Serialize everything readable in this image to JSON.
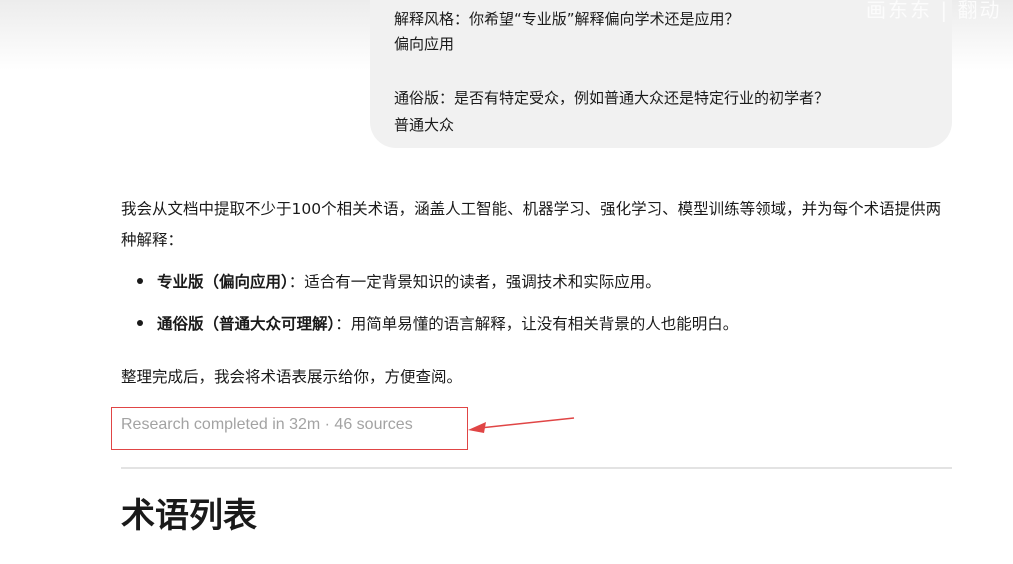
{
  "user_message": {
    "style_question": "解释风格：你希望“专业版”解释偏向学术还是应用？",
    "style_answer": "偏向应用",
    "audience_question": "通俗版：是否有特定受众，例如普通大众还是特定行业的初学者？",
    "audience_answer": "普通大众"
  },
  "watermark": "画东东 | 翻动",
  "assistant_reply": {
    "intro": "我会从文档中提取不少于100个相关术语，涵盖人工智能、机器学习、强化学习、模型训练等领域，并为每个术语提供两种解释：",
    "bullets": [
      {
        "title": "专业版（偏向应用）",
        "text": "：适合有一定背景知识的读者，强调技术和实际应用。"
      },
      {
        "title": "通俗版（普通大众可理解）",
        "text": "：用简单易懂的语言解释，让没有相关背景的人也能明白。"
      }
    ],
    "outro": "整理完成后，我会将术语表展示给你，方便查阅。"
  },
  "research_status": "Research completed in 32m · 46 sources",
  "section_heading": "术语列表",
  "colors": {
    "annotation_red": "#e04545",
    "bubble_bg": "#f1f1f1",
    "status_gray": "#a3a3a3"
  }
}
